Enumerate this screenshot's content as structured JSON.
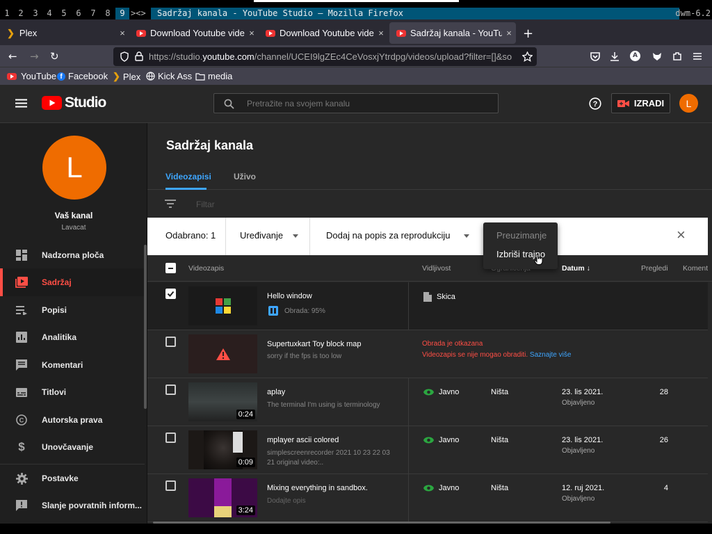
{
  "dwm": {
    "tags": [
      "1",
      "2",
      "3",
      "4",
      "5",
      "6",
      "7",
      "8",
      "9"
    ],
    "layout": "><>",
    "window_title": "Sadržaj kanala - YouTube Studio — Mozilla Firefox",
    "status": "dwm-6.2"
  },
  "firefox": {
    "tabs": [
      {
        "label": "Plex",
        "close": "×"
      },
      {
        "label": "Download Youtube video",
        "close": "×"
      },
      {
        "label": "Download Youtube video",
        "close": "×"
      },
      {
        "label": "Sadržaj kanala - YouTube",
        "close": "×"
      }
    ],
    "new_tab": "+",
    "url_prefix": "https://studio.",
    "url_domain": "youtube.com",
    "url_rest": "/channel/UCEI9lgZEc4CeVosxjYtrdpg/videos/upload?filter=[]&so",
    "bookmarks": [
      {
        "label": "YouTube",
        "icon": "youtube-icon"
      },
      {
        "label": "Facebook",
        "icon": "facebook-icon"
      },
      {
        "label": "Plex",
        "icon": "plex-icon"
      },
      {
        "label": "Kick Ass",
        "icon": "globe-icon"
      },
      {
        "label": "media",
        "icon": "folder-icon"
      }
    ],
    "ext_badge": "A"
  },
  "studio": {
    "logo_text": "Studio",
    "search_placeholder": "Pretražite na svojem kanalu",
    "create_label": "IZRADI",
    "avatar_letter": "L",
    "channel": {
      "label": "Vaš kanal",
      "name": "Lavacat",
      "avatar_letter": "L"
    },
    "nav": [
      {
        "label": "Nadzorna ploča",
        "icon": "dashboard-icon"
      },
      {
        "label": "Sadržaj",
        "icon": "content-icon"
      },
      {
        "label": "Popisi",
        "icon": "playlists-icon"
      },
      {
        "label": "Analitika",
        "icon": "analytics-icon"
      },
      {
        "label": "Komentari",
        "icon": "comments-icon"
      },
      {
        "label": "Titlovi",
        "icon": "subtitles-icon"
      },
      {
        "label": "Autorska prava",
        "icon": "copyright-icon"
      },
      {
        "label": "Unovčavanje",
        "icon": "monetization-icon"
      },
      {
        "label": "Postavke",
        "icon": "settings-icon"
      },
      {
        "label": "Slanje povratnih inform...",
        "icon": "feedback-icon"
      }
    ],
    "page_title": "Sadržaj kanala",
    "tabs": [
      "Videozapisi",
      "Uživo"
    ],
    "filter_placeholder": "Filtar",
    "selection": {
      "selected": "Odabrano: 1",
      "edit": "Uređivanje",
      "add_playlist": "Dodaj na popis za reprodukciju",
      "close": "×"
    },
    "dropdown": {
      "download": "Preuzimanje",
      "delete": "Izbriši trajno"
    },
    "columns": {
      "video": "Videozapis",
      "visibility": "Vidljivost",
      "restrictions": "Ograničenja",
      "date": "Datum",
      "views": "Pregledi",
      "comments": "Komentari"
    },
    "rows": [
      {
        "title": "Hello window",
        "desc": "",
        "processing": "Obrada: 95%",
        "visibility": "Skica",
        "restrictions": "",
        "date": "",
        "date_status": "",
        "views": "",
        "duration": "",
        "checked": true
      },
      {
        "title": "Supertuxkart Toy block map",
        "desc": "sorry if the fps is too low",
        "error": "Obrada je otkazana",
        "error_detail": "Videozapis se nije mogao obraditi.",
        "error_link": "Saznajte više",
        "checked": false
      },
      {
        "title": "aplay",
        "desc": "The terminal I'm using is terminology",
        "visibility": "Javno",
        "restrictions": "Ništa",
        "date": "23. lis 2021.",
        "date_status": "Objavljeno",
        "views": "28",
        "duration": "0:24",
        "checked": false
      },
      {
        "title": "mplayer ascii colored",
        "desc": "simplescreenrecorder 2021 10 23 22 03 21 original video:..",
        "visibility": "Javno",
        "restrictions": "Ništa",
        "date": "23. lis 2021.",
        "date_status": "Objavljeno",
        "views": "26",
        "duration": "0:09",
        "checked": false
      },
      {
        "title": "Mixing everything in sandbox.",
        "desc": "Dodajte opis",
        "visibility": "Javno",
        "restrictions": "Ništa",
        "date": "12. ruj 2021.",
        "date_status": "Objavljeno",
        "views": "4",
        "duration": "3:24",
        "checked": false
      }
    ]
  },
  "colors": {
    "accent_red": "#ff4e45",
    "tab_blue": "#3ea6ff",
    "public_green": "#2ba640",
    "error_red": "#ff4e45",
    "avatar_orange": "#ef6c00"
  }
}
